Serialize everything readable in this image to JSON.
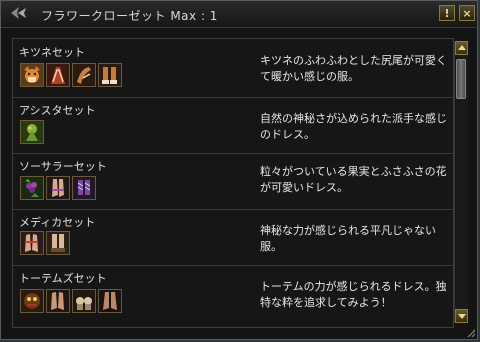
{
  "window": {
    "title": "フラワークローゼット Max : 1",
    "info_label": "!",
    "close_label": "×"
  },
  "outfits": [
    {
      "name": "キツネセット",
      "desc": "キツネのふわふわとした尻尾が可愛くて暖かい感じの服。",
      "icons": [
        "fox-head-icon",
        "fox-tail-outfit-icon",
        "fox-gloves-icon",
        "fox-boots-icon"
      ]
    },
    {
      "name": "アシスタセット",
      "desc": "自然の神秘さが込められた派手な感じのドレス。",
      "icons": [
        "flower-dress-icon"
      ]
    },
    {
      "name": "ソーサラーセット",
      "desc": "粒々がついている果実とふさふさの花が可愛いドレス。",
      "icons": [
        "grape-dress-icon",
        "sorcerer-gloves-icon",
        "sorcerer-boots-icon"
      ]
    },
    {
      "name": "メディカセット",
      "desc": "神秘な力が感じられる平凡じゃない服。",
      "icons": [
        "medica-gloves-icon",
        "medica-boots-icon"
      ]
    },
    {
      "name": "トーテムズセット",
      "desc": "トーテムの力が感じられるドレス。独特な粋を追求してみよう！",
      "icons": [
        "totem-mask-icon",
        "totem-gloves-icon",
        "totem-boots-icon",
        "totem-shoes-icon"
      ]
    }
  ]
}
